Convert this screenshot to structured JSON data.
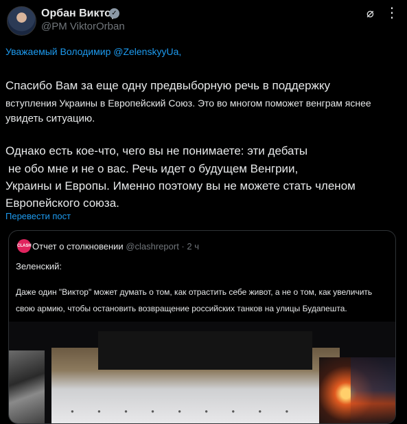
{
  "author": {
    "name": "Орбан Виктор",
    "handle": "@PM ViktorOrban",
    "verified_icon": "verified-badge-icon"
  },
  "header_icons": [
    "grok-icon",
    "more-icon"
  ],
  "post": {
    "greeting": "Уважаемый Володимир @ZelenskyyUa,",
    "lines": [
      "Спасибо Вам за еще одну предвыборную речь в поддержку",
      "вступления Украины в Европейский Союз. Это во многом поможет венграм яснее",
      "увидеть ситуацию.",
      "Однако есть кое-что, чего вы не понимаете: эти дебаты",
      "не обо мне и не о вас. Речь идет о будущем Венгрии,",
      "Украины и Европы. Именно поэтому вы не можете стать членом",
      "Европейского союза."
    ],
    "translate_link": "Перевести пост"
  },
  "quote": {
    "avatar_text": "CLASH",
    "author": "Отчет о столкновении",
    "handle_time": "@clashreport · 2 ч",
    "line1": "Зеленский:",
    "line2": "Даже один \"Виктор\" может думать о том, как отрастить себе живот, а не о том, как увеличить",
    "line3": "свою армию, чтобы остановить возвращение российских танков на улицы Будапешта."
  },
  "colors": {
    "background": "#000000",
    "text": "#e7e9ea",
    "link": "#1d9bf0",
    "muted": "#71767b"
  }
}
